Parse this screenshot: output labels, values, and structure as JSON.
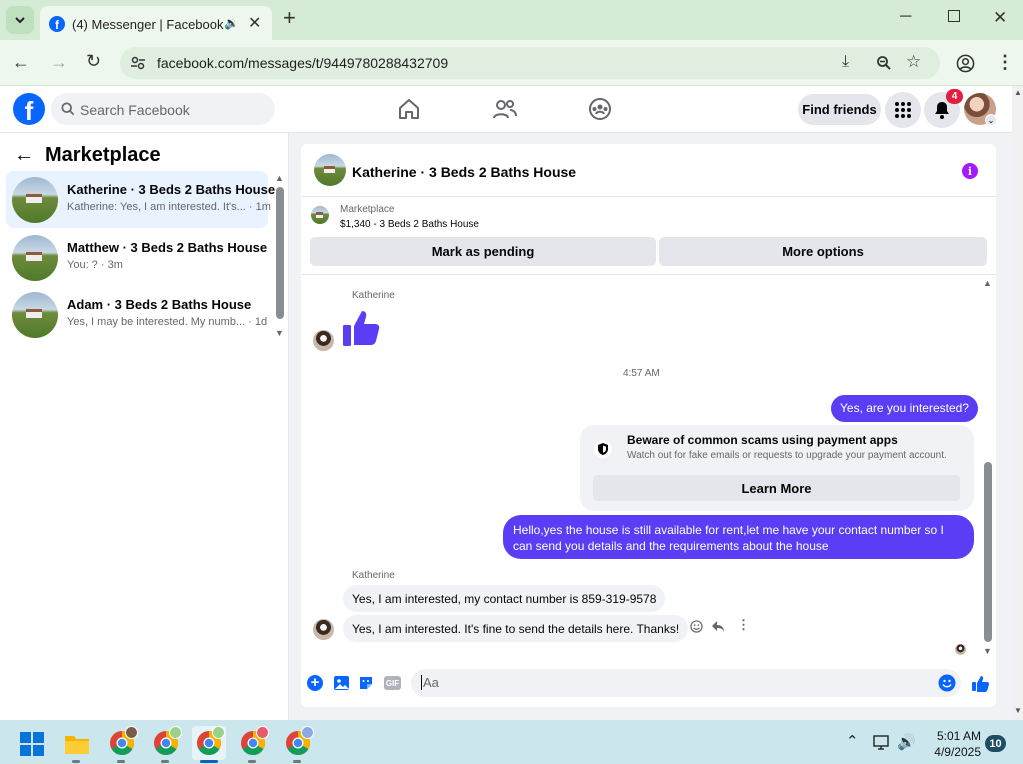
{
  "browser": {
    "tab_title": "(4) Messenger | Facebook",
    "url": "facebook.com/messages/t/9449780288432709"
  },
  "header": {
    "search_placeholder": "Search Facebook",
    "find_friends": "Find friends",
    "notification_count": "4"
  },
  "sidebar": {
    "title": "Marketplace",
    "conversations": [
      {
        "title": "Katherine · 3 Beds 2 Baths House",
        "preview": "Katherine: Yes, I am interested. It's...",
        "time": "1m"
      },
      {
        "title": "Matthew · 3 Beds 2 Baths House",
        "preview": "You: ?",
        "time": "3m"
      },
      {
        "title": "Adam · 3 Beds 2 Baths House",
        "preview": "Yes, I may be interested. My numb...",
        "time": "1d"
      }
    ]
  },
  "chat": {
    "title": "Katherine · 3 Beds 2 Baths House",
    "listing_source": "Marketplace",
    "listing_price_title": "$1,340 - 3 Beds 2 Baths House",
    "mark_pending": "Mark as pending",
    "more_options": "More options",
    "sender_name_1": "Katherine",
    "timestamp": "4:57 AM",
    "msg_me_1": "Yes, are you interested?",
    "scam_title": "Beware of common scams using payment apps",
    "scam_body": "Watch out for fake emails or requests to upgrade your payment account.",
    "learn_more": "Learn More",
    "msg_me_2": "Hello,yes the house is still available for rent,let me have your contact number so I can send you details and the requirements about the house",
    "sender_name_2": "Katherine",
    "msg_them_1": "Yes, I am interested, my contact number is 859-319-9578",
    "msg_them_2": "Yes, I am interested. It's fine to send the details here. Thanks!",
    "composer_placeholder": "Aa"
  },
  "taskbar": {
    "time": "5:01 AM",
    "date": "4/9/2025",
    "notification_count": "10"
  },
  "colors": {
    "accent": "#5b3df5",
    "fb_blue": "#0866ff",
    "chrome_green": "#d6ebd6"
  }
}
